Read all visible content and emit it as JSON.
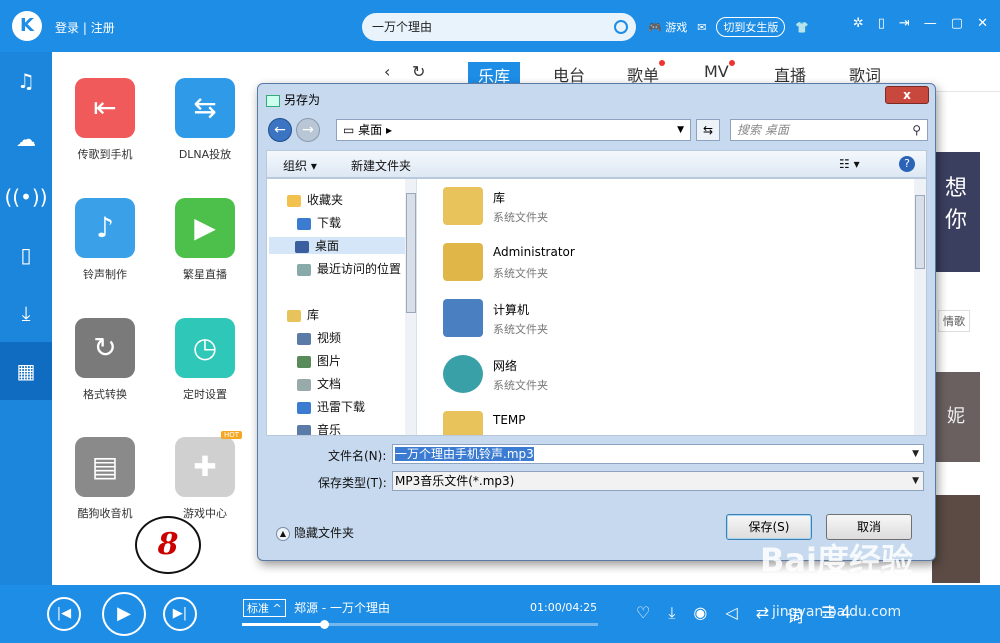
{
  "topbar": {
    "logo": "K",
    "login": "登录",
    "register": "注册",
    "search_value": "一万个理由",
    "games": "游戏",
    "switch_version": "切到女生版",
    "accent": "#1e8de6"
  },
  "sidebar": {
    "items": [
      {
        "icon": "music-note-icon",
        "glyph": "♫"
      },
      {
        "icon": "cloud-icon",
        "glyph": "☁"
      },
      {
        "icon": "radio-antenna-icon",
        "glyph": "📡"
      },
      {
        "icon": "device-icon",
        "glyph": "▯"
      },
      {
        "icon": "download-icon",
        "glyph": "⤓"
      },
      {
        "icon": "apps-grid-icon",
        "glyph": "▦"
      }
    ]
  },
  "tools": {
    "items": [
      {
        "label": "传歌到手机",
        "color": "#f05a5a",
        "glyph": "📱"
      },
      {
        "label": "DLNA投放",
        "color": "#2f9be8",
        "glyph": "⇆"
      },
      {
        "label": "铃声制作",
        "color": "#3aa0e8",
        "glyph": "🔔"
      },
      {
        "label": "繁星直播",
        "color": "#4cc04a",
        "glyph": "▶"
      },
      {
        "label": "格式转换",
        "color": "#7a7a7a",
        "glyph": "↻"
      },
      {
        "label": "定时设置",
        "color": "#2ec7b8",
        "glyph": "⏰"
      },
      {
        "label": "酷狗收音机",
        "color": "#8a8a8a",
        "glyph": "📻"
      },
      {
        "label": "游戏中心",
        "color": "#d0d0d0",
        "glyph": "🎮",
        "badge": "HOT"
      }
    ],
    "annotation_number": "8"
  },
  "nav": {
    "tabs": [
      "乐库",
      "电台",
      "歌单",
      "MV",
      "直播",
      "歌词"
    ],
    "active": "乐库"
  },
  "content": {
    "banner_text": "想\n你",
    "qingge": "情歌",
    "banner2_text": "妮"
  },
  "dialog": {
    "title": "另存为",
    "close": "x",
    "address": "桌面",
    "search_placeholder": "搜索 桌面",
    "organize": "组织 ▾",
    "new_folder": "新建文件夹",
    "tree": [
      {
        "label": "收藏夹",
        "icon": "star-icon",
        "color": "#f2c14e"
      },
      {
        "label": "下载",
        "icon": "download-folder-icon",
        "color": "#3b7bd1"
      },
      {
        "label": "桌面",
        "icon": "desktop-icon",
        "color": "#3b5f9e",
        "selected": true
      },
      {
        "label": "最近访问的位置",
        "icon": "recent-icon",
        "color": "#8aa"
      },
      {
        "label": "库",
        "icon": "library-icon",
        "color": "#e8c25a"
      },
      {
        "label": "视频",
        "icon": "video-icon",
        "color": "#5a7aa8"
      },
      {
        "label": "图片",
        "icon": "picture-icon",
        "color": "#5a8a5a"
      },
      {
        "label": "文档",
        "icon": "document-icon",
        "color": "#9aa"
      },
      {
        "label": "迅雷下载",
        "icon": "thunder-icon",
        "color": "#3b7bd1"
      },
      {
        "label": "音乐",
        "icon": "music-icon",
        "color": "#5a7aa8"
      }
    ],
    "files": [
      {
        "name": "库",
        "desc": "系统文件夹",
        "color": "#e8c25a"
      },
      {
        "name": "Administrator",
        "desc": "系统文件夹",
        "color": "#e0b648"
      },
      {
        "name": "计算机",
        "desc": "系统文件夹",
        "color": "#4a7fc1"
      },
      {
        "name": "网络",
        "desc": "系统文件夹",
        "color": "#3aa0a8"
      },
      {
        "name": "TEMP",
        "desc": "",
        "color": "#e8c25a"
      }
    ],
    "filename_label": "文件名(N):",
    "filename_value": "一万个理由手机铃声.mp3",
    "type_label": "保存类型(T):",
    "type_value": "MP3音乐文件(*.mp3)",
    "hide_folders": "隐藏文件夹",
    "save": "保存(S)",
    "cancel": "取消"
  },
  "player": {
    "quality": "标准",
    "song": "郑源 - 一万个理由",
    "time": "01:00/04:25",
    "progress": 0.23,
    "lyrics": "词",
    "playlist_count": "4"
  },
  "watermark": {
    "logo": "Bai度经验",
    "url": "jingyan.baidu.com"
  }
}
